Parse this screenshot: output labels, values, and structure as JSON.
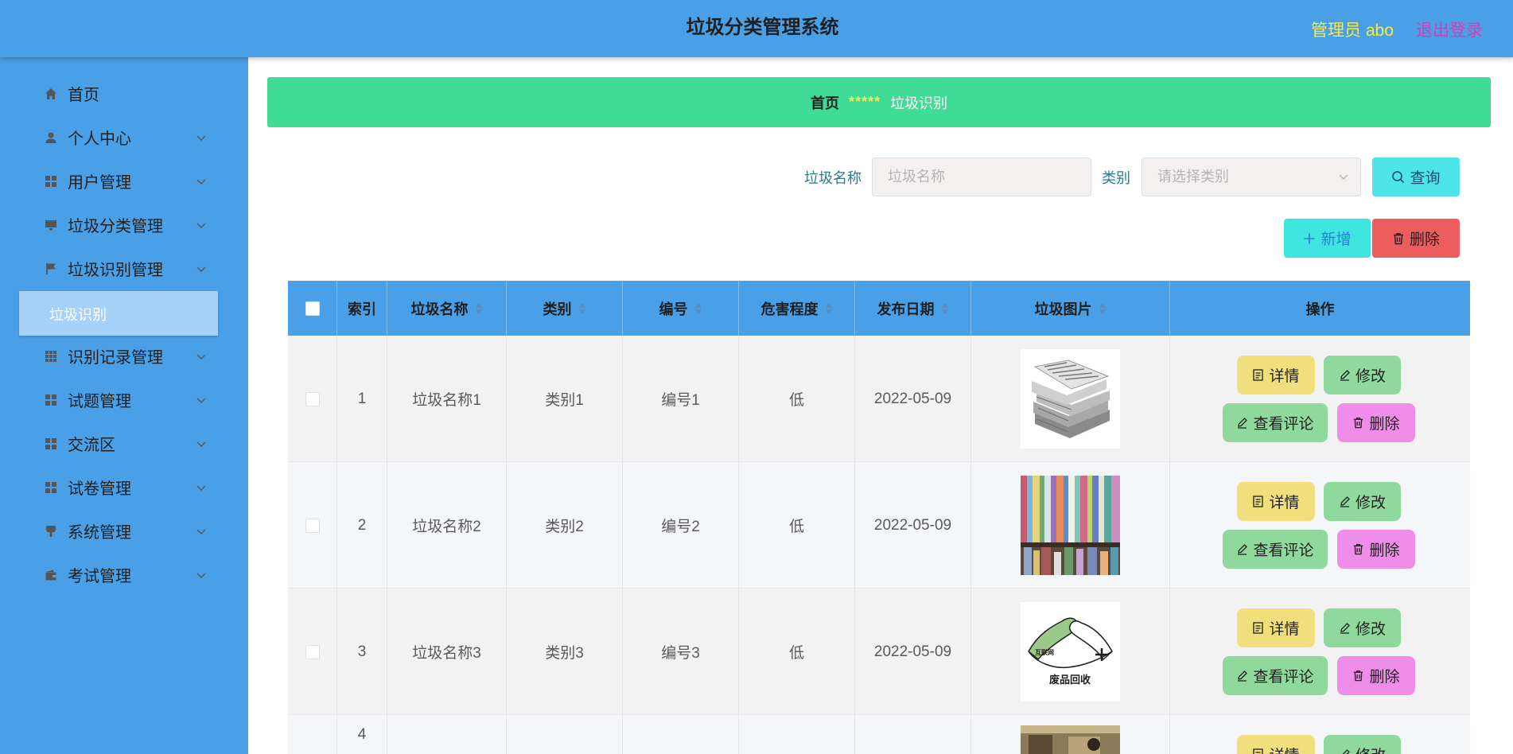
{
  "header": {
    "title": "垃圾分类管理系统",
    "admin": "管理员 abo",
    "logout": "退出登录"
  },
  "sidebar": {
    "items": [
      {
        "label": "首页",
        "icon": "home-icon"
      },
      {
        "label": "个人中心",
        "icon": "user-icon"
      },
      {
        "label": "用户管理",
        "icon": "grid-icon"
      },
      {
        "label": "垃圾分类管理",
        "icon": "monitor-icon"
      },
      {
        "label": "垃圾识别管理",
        "icon": "flag-icon"
      },
      {
        "label": "识别记录管理",
        "icon": "apps-icon"
      },
      {
        "label": "试题管理",
        "icon": "grid-icon"
      },
      {
        "label": "交流区",
        "icon": "grid-icon"
      },
      {
        "label": "试卷管理",
        "icon": "grid-icon"
      },
      {
        "label": "系统管理",
        "icon": "brush-icon"
      },
      {
        "label": "考试管理",
        "icon": "wallet-icon"
      }
    ],
    "active_sub": "垃圾识别"
  },
  "breadcrumb": {
    "home": "首页",
    "separator": "*****",
    "current": "垃圾识别"
  },
  "search": {
    "name_label": "垃圾名称",
    "name_placeholder": "垃圾名称",
    "category_label": "类别",
    "category_placeholder": "请选择类别",
    "query_button": "查询"
  },
  "toolbar": {
    "add_button": "新增",
    "delete_button": "删除"
  },
  "table": {
    "columns": [
      "索引",
      "垃圾名称",
      "类别",
      "编号",
      "危害程度",
      "发布日期",
      "垃圾图片",
      "操作"
    ],
    "rows": [
      {
        "index": "1",
        "name": "垃圾名称1",
        "category": "类别1",
        "code": "编号1",
        "hazard": "低",
        "date": "2022-05-09",
        "image": "newspaper-stack"
      },
      {
        "index": "2",
        "name": "垃圾名称2",
        "category": "类别2",
        "code": "编号2",
        "hazard": "低",
        "date": "2022-05-09",
        "image": "bookshelf"
      },
      {
        "index": "3",
        "name": "垃圾名称3",
        "category": "类别3",
        "code": "编号3",
        "hazard": "低",
        "date": "2022-05-09",
        "image": "recycling-logo"
      },
      {
        "index": "4",
        "name": "",
        "category": "",
        "code": "",
        "hazard": "",
        "date": "",
        "image": "photo-partial"
      }
    ],
    "actions": {
      "detail": "详情",
      "edit": "修改",
      "comments": "查看评论",
      "delete": "删除"
    },
    "recycle_logo_text": "废品回收",
    "recycle_logo_brand": "互联网"
  },
  "colors": {
    "header_bg": "#4aa0e6",
    "breadcrumb_bg": "#3fdb97",
    "query_btn": "#4de4ea",
    "add_btn": "#3ee6df",
    "delete_btn": "#ee5d5d",
    "detail_btn": "#f0df7c",
    "edit_btn": "#8ed99b",
    "row_delete_btn": "#ef8de8"
  }
}
